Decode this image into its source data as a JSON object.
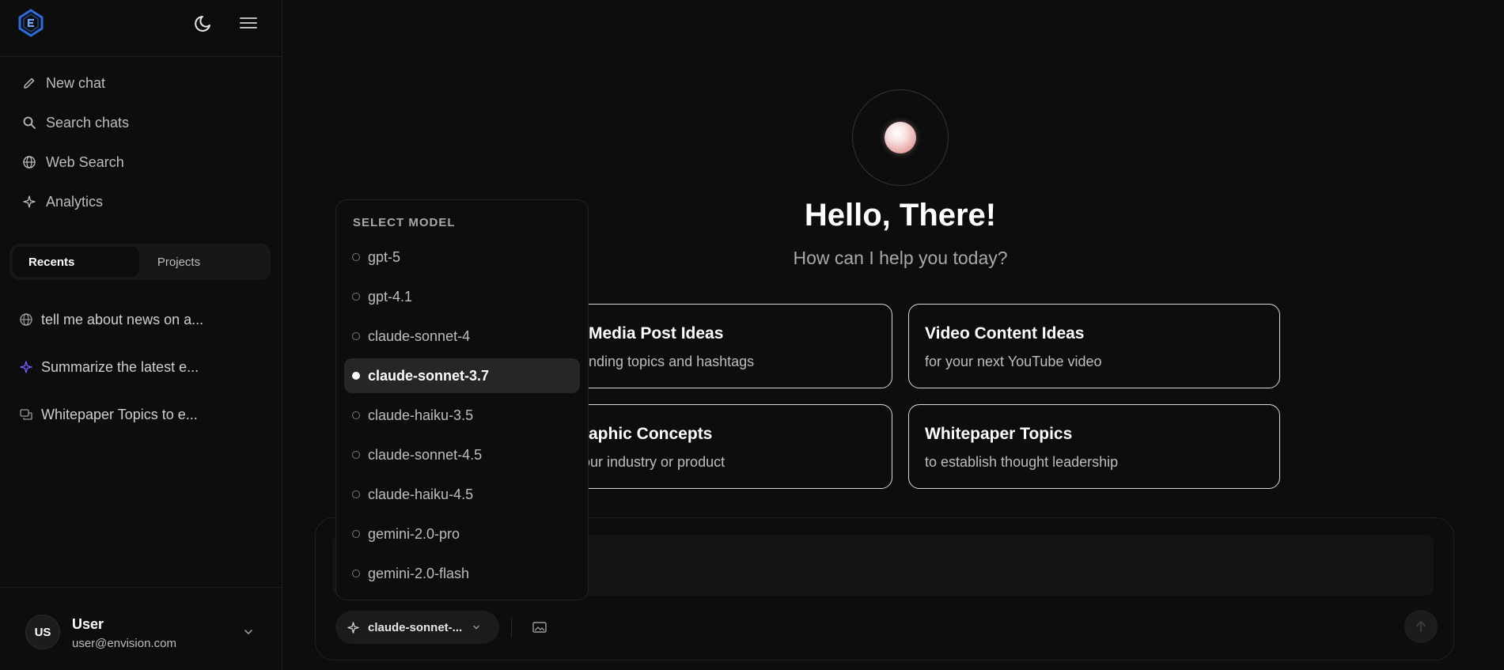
{
  "sidebar": {
    "nav": [
      {
        "label": "New chat",
        "icon": "pencil-icon"
      },
      {
        "label": "Search chats",
        "icon": "search-icon"
      },
      {
        "label": "Web Search",
        "icon": "globe-icon"
      },
      {
        "label": "Analytics",
        "icon": "sparkles-icon"
      }
    ],
    "tabs": {
      "recents": "Recents",
      "projects": "Projects"
    },
    "recents": [
      {
        "label": "tell me about news on a...",
        "icon": "globe-icon"
      },
      {
        "label": "Summarize the latest e...",
        "icon": "sparkles-icon"
      },
      {
        "label": "Whitepaper Topics to e...",
        "icon": "chat-icon"
      }
    ],
    "user": {
      "initials": "US",
      "name": "User",
      "email": "user@envision.com"
    }
  },
  "main": {
    "greeting": "Hello, There!",
    "subtitle": "How can I help you today?",
    "cards": [
      {
        "title": "Media Post Ideas",
        "desc": "nding topics and hashtags"
      },
      {
        "title": "Video Content Ideas",
        "desc": "for your next YouTube video"
      },
      {
        "title": "aphic Concepts",
        "desc": "our industry or product"
      },
      {
        "title": "Whitepaper Topics",
        "desc": "to establish thought leadership"
      }
    ]
  },
  "composer": {
    "model_label": "claude-sonnet-..."
  },
  "model_menu": {
    "heading": "SELECT MODEL",
    "selected": "claude-sonnet-3.7",
    "options": [
      "gpt-5",
      "gpt-4.1",
      "claude-sonnet-4",
      "claude-sonnet-3.7",
      "claude-haiku-3.5",
      "claude-sonnet-4.5",
      "claude-haiku-4.5",
      "gemini-2.0-pro",
      "gemini-2.0-flash"
    ]
  },
  "colors": {
    "background": "#0d0d0d",
    "accent": "#7c5cff",
    "logo": "#2d6cdf"
  }
}
